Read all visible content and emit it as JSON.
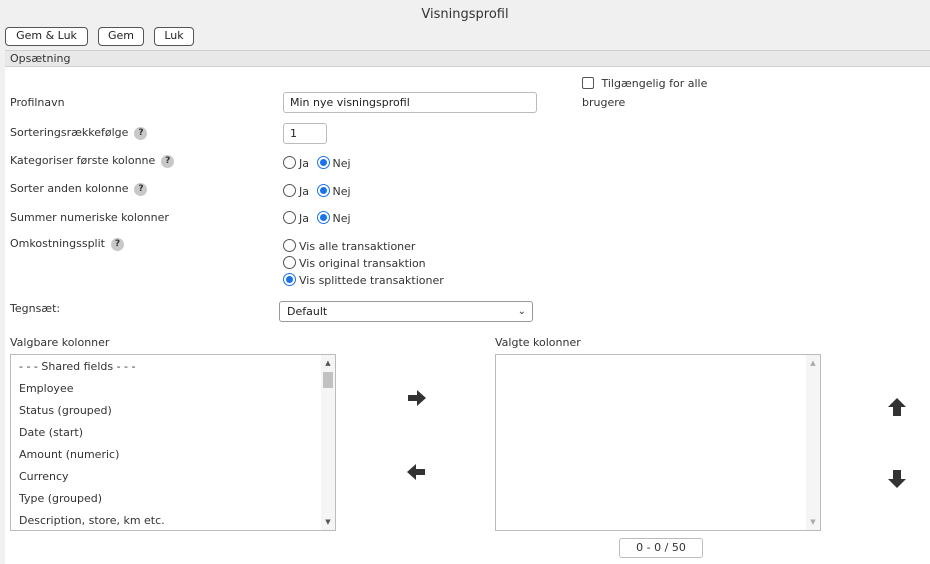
{
  "window": {
    "title": "Visningsprofil"
  },
  "toolbar": {
    "save_close": "Gem & Luk",
    "save": "Gem",
    "close": "Luk"
  },
  "section": {
    "title": "Opsætning"
  },
  "form": {
    "profile_name_label": "Profilnavn",
    "profile_name_value": "Min nye visningsprofil",
    "available_all_line1": "Tilgængelig for alle",
    "available_all_line2": "brugere",
    "sort_order_label": "Sorteringsrækkefølge",
    "sort_order_value": "1",
    "categorize_label": "Kategoriser første kolonne",
    "sort_second_label": "Sorter anden kolonne",
    "sum_numeric_label": "Summer numeriske kolonner",
    "yes": "Ja",
    "no": "Nej",
    "cost_split_label": "Omkostningssplit",
    "cost_split_options": [
      "Vis alle transaktioner",
      "Vis original transaktion",
      "Vis splittede transaktioner"
    ],
    "charset_label": "Tegnsæt:",
    "charset_value": "Default",
    "help_glyph": "?"
  },
  "columns": {
    "available_label": "Valgbare kolonner",
    "selected_label": "Valgte kolonner",
    "available_items": [
      "- - - Shared fields - - -",
      "Employee",
      "Status (grouped)",
      "Date (start)",
      "Amount (numeric)",
      "Currency",
      "Type (grouped)",
      "Description, store, km etc."
    ],
    "selected_items": [],
    "counter": "0 - 0 / 50"
  },
  "colors": {
    "accent": "#1a73e8",
    "panel_bg": "#ffffff",
    "window_bg": "#f0f0f0"
  }
}
